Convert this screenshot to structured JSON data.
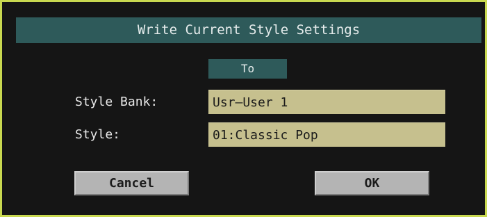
{
  "dialog": {
    "title": "Write Current Style Settings",
    "to_label": "To",
    "style_bank_label": "Style Bank:",
    "style_bank_value": "Usr—User 1",
    "style_label": "Style:",
    "style_value": "01:Classic Pop",
    "cancel_label": "Cancel",
    "ok_label": "OK"
  },
  "colors": {
    "frame": "#c8d850",
    "background": "#151515",
    "title_bar": "#2e5a5a",
    "field": "#c6c08e",
    "button": "#b4b4b4"
  }
}
